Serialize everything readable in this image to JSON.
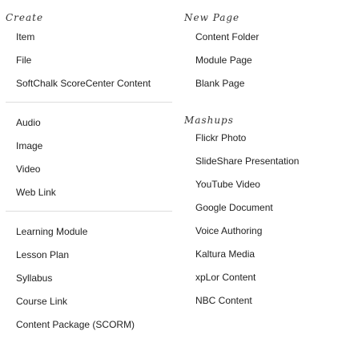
{
  "create": {
    "heading": "Create",
    "group1": [
      "Item",
      "File",
      "SoftChalk ScoreCenter Content"
    ],
    "group2": [
      "Audio",
      "Image",
      "Video",
      "Web Link"
    ],
    "group3": [
      "Learning Module",
      "Lesson Plan",
      "Syllabus",
      "Course Link",
      "Content Package (SCORM)"
    ]
  },
  "new_page": {
    "heading": "New Page",
    "items": [
      "Content Folder",
      "Module Page",
      "Blank Page"
    ]
  },
  "mashups": {
    "heading": "Mashups",
    "items": [
      "Flickr Photo",
      "SlideShare Presentation",
      "YouTube Video",
      "Google Document",
      "Voice Authoring",
      "Kaltura Media",
      "xpLor Content",
      "NBC Content"
    ]
  }
}
